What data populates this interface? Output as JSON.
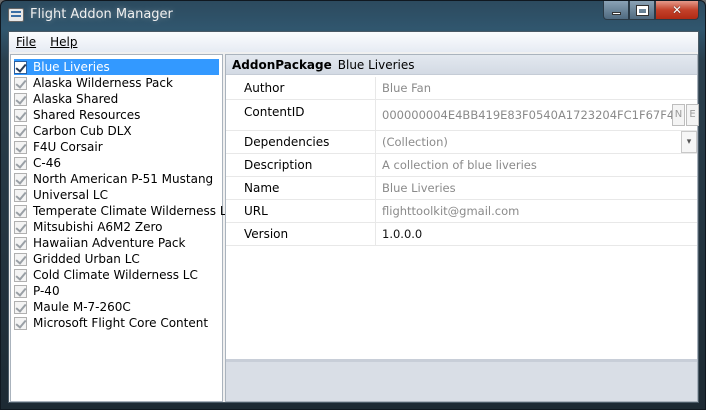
{
  "window": {
    "title": "Flight Addon Manager"
  },
  "menu": {
    "file_label": "File",
    "help_label": "Help"
  },
  "addons": [
    {
      "label": "Blue Liveries",
      "checked": true,
      "selected": true
    },
    {
      "label": "Alaska Wilderness Pack",
      "checked": true
    },
    {
      "label": "Alaska Shared",
      "checked": true
    },
    {
      "label": "Shared Resources",
      "checked": true
    },
    {
      "label": "Carbon Cub DLX",
      "checked": true
    },
    {
      "label": "F4U Corsair",
      "checked": true
    },
    {
      "label": "C-46",
      "checked": true
    },
    {
      "label": "North American P-51 Mustang",
      "checked": true
    },
    {
      "label": "Universal LC",
      "checked": true
    },
    {
      "label": "Temperate Climate Wilderness LC",
      "checked": true
    },
    {
      "label": "Mitsubishi A6M2 Zero",
      "checked": true
    },
    {
      "label": "Hawaiian Adventure Pack",
      "checked": true
    },
    {
      "label": "Gridded Urban LC",
      "checked": true
    },
    {
      "label": "Cold Climate Wilderness LC",
      "checked": true
    },
    {
      "label": "P-40",
      "checked": true
    },
    {
      "label": "Maule M-7-260C",
      "checked": true
    },
    {
      "label": "Microsoft Flight Core Content",
      "checked": true
    }
  ],
  "properties": {
    "type": "AddonPackage",
    "name": "Blue Liveries",
    "rows": [
      {
        "key": "Author",
        "value": "Blue Fan"
      },
      {
        "key": "ContentID",
        "value": "000000004E4BB419E83F0540A1723204FC1F67F4",
        "btn1": "N",
        "btn2": "E"
      },
      {
        "key": "Dependencies",
        "value": "(Collection)"
      },
      {
        "key": "Description",
        "value": "A collection of blue liveries"
      },
      {
        "key": "Name",
        "value": "Blue Liveries"
      },
      {
        "key": "URL",
        "value": "flighttoolkit@gmail.com"
      },
      {
        "key": "Version",
        "value": "1.0.0.0"
      }
    ]
  }
}
